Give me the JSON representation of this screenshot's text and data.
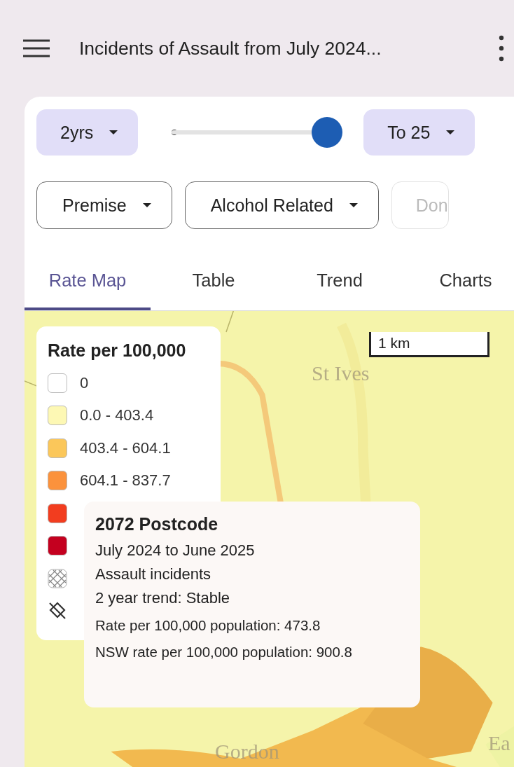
{
  "app_bar": {
    "title": "Incidents of Assault from July 2024..."
  },
  "period": {
    "label": "2yrs"
  },
  "slider": {
    "level": 1
  },
  "end_year": {
    "label": "To 25"
  },
  "filters": [
    {
      "label": "Premise",
      "faded": false
    },
    {
      "label": "Alcohol Related",
      "faded": false
    },
    {
      "label": "Don",
      "faded": true
    }
  ],
  "tabs": [
    {
      "label": "Rate Map",
      "selected": true
    },
    {
      "label": "Table",
      "selected": false
    },
    {
      "label": "Trend",
      "selected": false
    },
    {
      "label": "Charts",
      "selected": false
    }
  ],
  "map": {
    "scale": "1 km",
    "places": [
      {
        "name": "St Ives",
        "kind": "north"
      },
      {
        "name": "Gordon",
        "kind": "south"
      },
      {
        "name": "Ea",
        "kind": "east"
      }
    ]
  },
  "legend": {
    "title": "Rate per 100,000",
    "items": [
      {
        "kind": "swatch",
        "color": "#ffffff",
        "label": "0"
      },
      {
        "kind": "swatch",
        "color": "#fdf8b4",
        "label": "0.0 - 403.4"
      },
      {
        "kind": "swatch",
        "color": "#fbc75a",
        "label": "403.4 - 604.1"
      },
      {
        "kind": "swatch",
        "color": "#fb923c",
        "label": "604.1 - 837.7"
      },
      {
        "kind": "swatch",
        "color": "#f23d1f"
      },
      {
        "kind": "swatch",
        "color": "#c4001f"
      },
      {
        "kind": "hatch"
      },
      {
        "kind": "none"
      }
    ]
  },
  "tooltip": {
    "title": "2072 Postcode",
    "lines": [
      {
        "text": "July 2024 to June 2025",
        "kind": "main"
      },
      {
        "text": "Assault incidents",
        "kind": "main"
      },
      {
        "text": "2 year trend: Stable",
        "kind": "main"
      },
      {
        "text": "Rate per 100,000 population: 473.8",
        "kind": "detail"
      },
      {
        "text": "NSW rate per 100,000 population: 900.8",
        "kind": "detail"
      }
    ]
  }
}
